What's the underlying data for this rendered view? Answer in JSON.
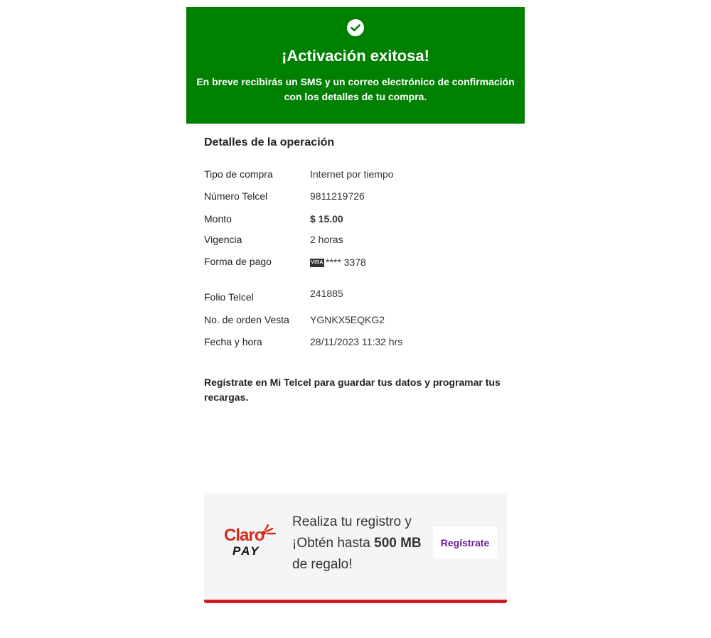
{
  "banner": {
    "title": "¡Activación exitosa!",
    "message": "En breve recibirás un SMS y un correo electrónico de confirmación con los detalles de tu compra.",
    "color": "#008000"
  },
  "details": {
    "title": "Detalles de la operación",
    "rows": {
      "purchase_type": {
        "label": "Tipo de compra",
        "value": "Internet por tiempo"
      },
      "phone_number": {
        "label": "Número Telcel",
        "value": "9811219726"
      },
      "amount": {
        "label": "Monto",
        "value": "$ 15.00"
      },
      "validity": {
        "label": "Vigencia",
        "value": "2 horas"
      },
      "payment": {
        "label": "Forma de pago",
        "card_brand": "VISA",
        "card_mask": "**** 3378"
      },
      "folio": {
        "label": "Folio Telcel",
        "value": "241885"
      },
      "order": {
        "label": "No. de orden Vesta",
        "value": "YGNKX5EQKG2"
      },
      "datetime": {
        "label": "Fecha y hora",
        "value": "28/11/2023 11:32 hrs"
      }
    }
  },
  "register_note": "Regístrate en Mi Telcel para guardar tus datos y programar tus recargas.",
  "promo": {
    "logo_word": "Claro",
    "logo_sub": "PAY",
    "text_prefix": "Realiza tu registro y ¡Obtén hasta ",
    "text_bold": "500 MB",
    "text_suffix": " de regalo!",
    "button_label": "Regístrate",
    "accent_color": "#cc1f1f",
    "button_color": "#6a1b9a"
  }
}
